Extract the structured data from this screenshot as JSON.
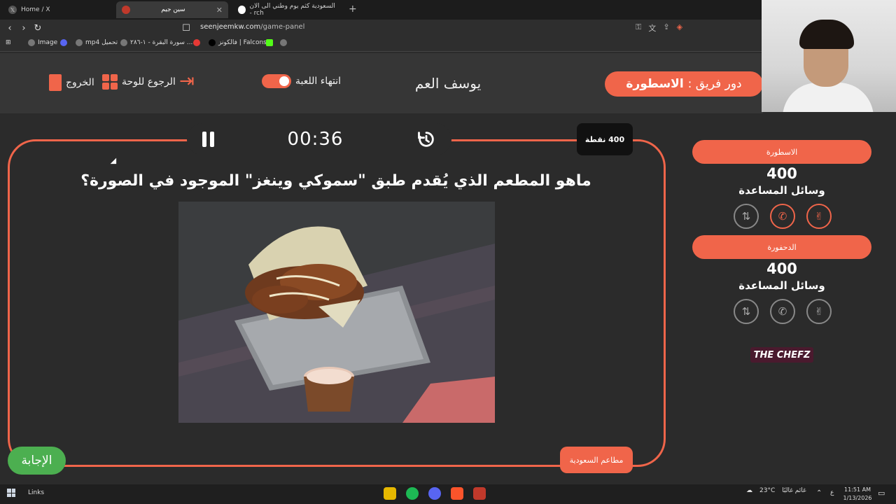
{
  "browser": {
    "tabs": [
      {
        "label": "Home / X",
        "icon": "x-logo-icon"
      },
      {
        "label": "سين جيم",
        "icon": "seenjeem-icon",
        "active": true
      },
      {
        "label": "السعودية كثم يوم وطني الى الان - rch",
        "icon": "google-icon"
      }
    ],
    "url_domain": "seenjeemkw.com",
    "url_path": "/game-panel",
    "bookmarks": [
      "Image",
      "mp4 تحميل",
      "سورة البقرة - ١-٢٨٦ ...",
      "فالكونز | Falcons"
    ]
  },
  "header": {
    "turn_prefix": "دور فريق :",
    "turn_team": "الاسطورة",
    "player_name": "يوسف العم",
    "end_game": "انتهاء اللعبة",
    "back_to_board": "الرجوع للوحة",
    "exit": "الخروج"
  },
  "question": {
    "timer": "00:36",
    "points": "400 نقطة",
    "text": "ماهو المطعم الذي يُقدم طبق \"سموكي وينغز\" الموجود في الصورة؟",
    "category": "مطاعم السعودية",
    "answer_button": "الإجابة"
  },
  "teams": [
    {
      "name": "الاسطورة",
      "score": "400",
      "helpers_label": "وسائل المساعدة"
    },
    {
      "name": "الدحفورة",
      "score": "400",
      "helpers_label": "وسائل المساعدة"
    }
  ],
  "sponsor": "THE CHEFZ",
  "taskbar": {
    "links": "Links",
    "weather": "23°C",
    "weather_text": "غائم غالبًا",
    "lang": "ع",
    "time": "11:51 AM",
    "date": "1/13/2026"
  },
  "colors": {
    "accent": "#f0654a",
    "answer": "#4caf50"
  }
}
